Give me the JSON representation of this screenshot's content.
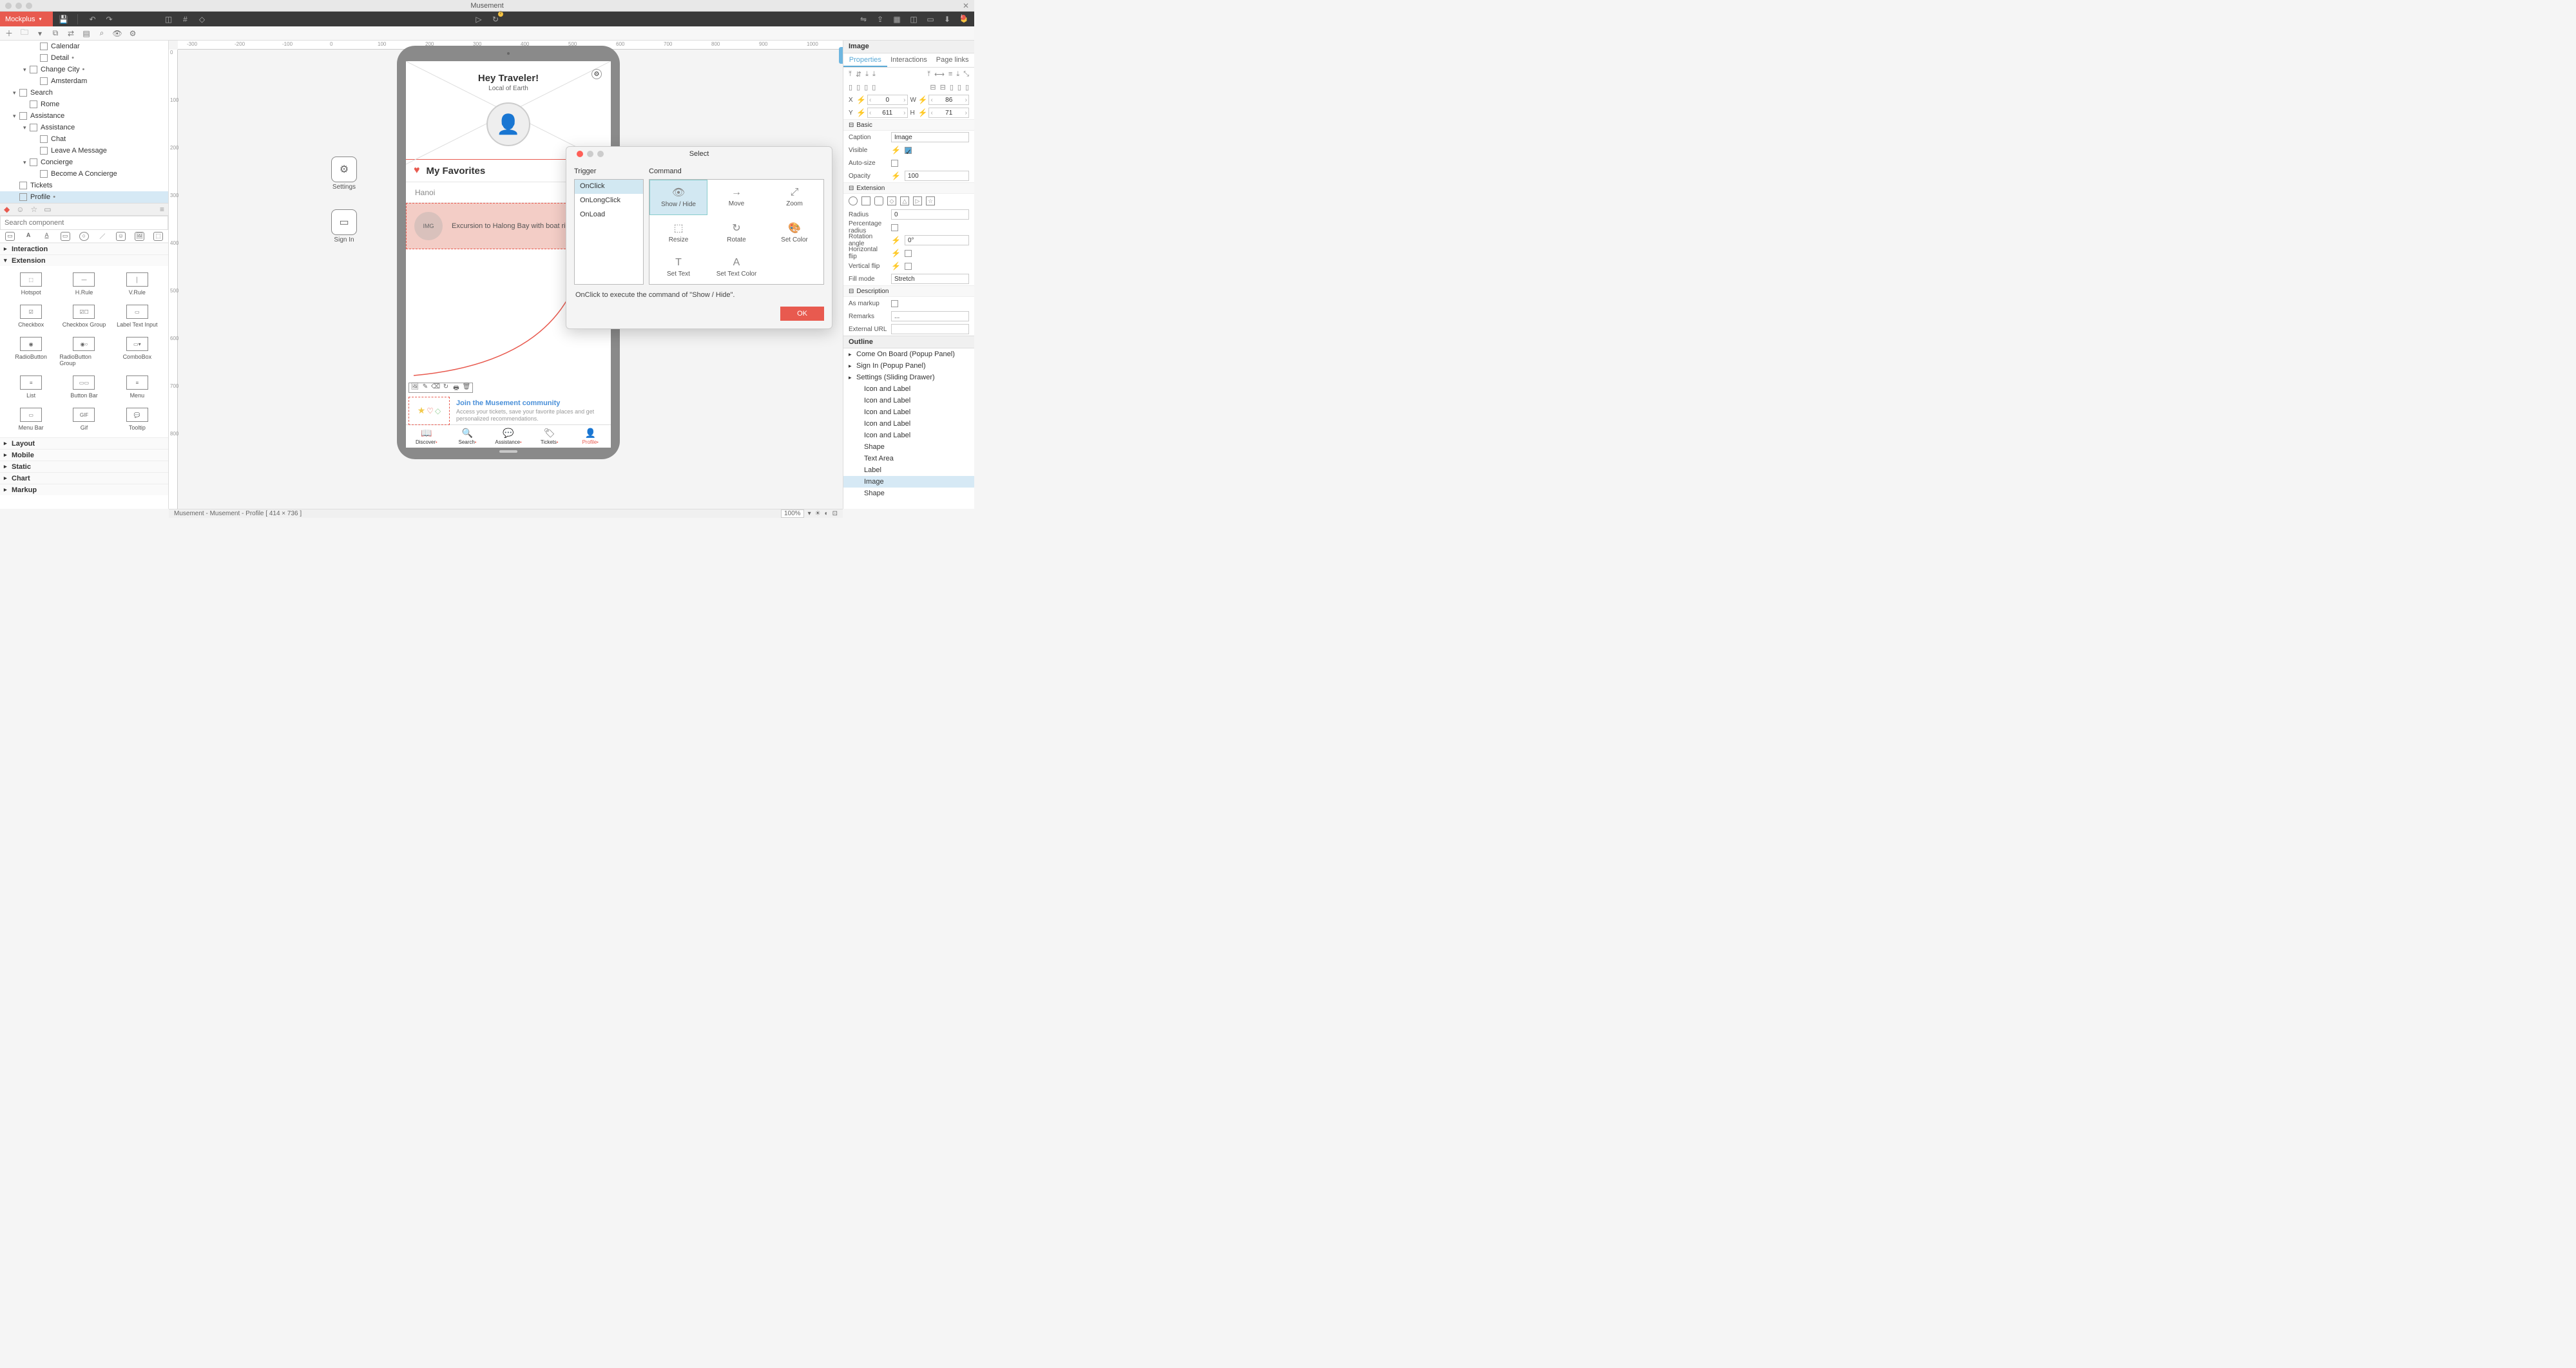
{
  "window": {
    "title": "Musement"
  },
  "brand": "Mockplus",
  "tree": [
    {
      "depth": 3,
      "label": "Calendar",
      "dot": false,
      "chev": ""
    },
    {
      "depth": 3,
      "label": "Detail",
      "dot": true,
      "chev": ""
    },
    {
      "depth": 2,
      "label": "Change City",
      "dot": true,
      "chev": "▾"
    },
    {
      "depth": 3,
      "label": "Amsterdam",
      "dot": false,
      "chev": ""
    },
    {
      "depth": 1,
      "label": "Search",
      "dot": false,
      "chev": "▾"
    },
    {
      "depth": 2,
      "label": "Rome",
      "dot": false,
      "chev": ""
    },
    {
      "depth": 1,
      "label": "Assistance",
      "dot": false,
      "chev": "▾"
    },
    {
      "depth": 2,
      "label": "Assistance",
      "dot": false,
      "chev": "▾"
    },
    {
      "depth": 3,
      "label": "Chat",
      "dot": false,
      "chev": ""
    },
    {
      "depth": 3,
      "label": "Leave A Message",
      "dot": false,
      "chev": ""
    },
    {
      "depth": 2,
      "label": "Concierge",
      "dot": false,
      "chev": "▾"
    },
    {
      "depth": 3,
      "label": "Become A Concierge",
      "dot": false,
      "chev": ""
    },
    {
      "depth": 1,
      "label": "Tickets",
      "dot": false,
      "chev": ""
    },
    {
      "depth": 1,
      "label": "Profile",
      "dot": true,
      "chev": "",
      "selected": true
    }
  ],
  "search": {
    "placeholder": "Search component"
  },
  "categories": {
    "interaction": "Interaction",
    "extension": "Extension",
    "layout": "Layout",
    "mobile": "Mobile",
    "static": "Static",
    "chart": "Chart",
    "markup": "Markup"
  },
  "components": [
    "Hotspot",
    "H.Rule",
    "V.Rule",
    "Checkbox",
    "Checkbox Group",
    "Label Text Input",
    "RadioButton",
    "RadioButton Group",
    "ComboBox",
    "List",
    "Button Bar",
    "Menu",
    "Menu Bar",
    "Gif",
    "Tooltip"
  ],
  "floaters": {
    "settings": "Settings",
    "signin": "Sign In"
  },
  "mock": {
    "greeting": "Hey Traveler!",
    "subtitle": "Local of Earth",
    "favHead": "My Favorites",
    "city": "Hanoi",
    "imgLabel": "IMG",
    "selText": "Excursion to Halong Bay with boat rid",
    "commTitle": "Join the Musement community",
    "commBody": "Access your tickets, save your favorite places and get personalized recommendations.",
    "tabs": [
      "Discover",
      "Search",
      "Assistance",
      "Tickets",
      "Profile"
    ]
  },
  "modal": {
    "title": "Select",
    "triggerHead": "Trigger",
    "commandHead": "Command",
    "triggers": [
      "OnClick",
      "OnLongClick",
      "OnLoad"
    ],
    "commands": [
      "Show / Hide",
      "Move",
      "Zoom",
      "Resize",
      "Rotate",
      "Set Color",
      "Set Text",
      "Set Text Color"
    ],
    "message": "OnClick to execute the command of \"Show / Hide\".",
    "ok": "OK"
  },
  "props": {
    "head": "Image",
    "tabs": [
      "Properties",
      "Interactions",
      "Page links"
    ],
    "X": "0",
    "Y": "611",
    "W": "86",
    "H": "71",
    "basic": "Basic",
    "caption": "Caption",
    "captionVal": "Image",
    "visible": "Visible",
    "autosize": "Auto-size",
    "opacity": "Opacity",
    "opacityVal": "100",
    "extension": "Extension",
    "radius": "Radius",
    "radiusVal": "0",
    "pradius": "Percentage radius",
    "rot": "Rotation angle",
    "rotVal": "0°",
    "hflip": "Horizontal flip",
    "vflip": "Vertical flip",
    "fill": "Fill mode",
    "fillVal": "Stretch",
    "desc": "Description",
    "markup": "As markup",
    "remarks": "Remarks",
    "remarksVal": "...",
    "url": "External URL"
  },
  "outline": {
    "head": "Outline",
    "items": [
      {
        "label": "Come On Board (Popup Panel)",
        "chev": "▸"
      },
      {
        "label": "Sign In (Popup Panel)",
        "chev": "▸"
      },
      {
        "label": "Settings (Sliding Drawer)",
        "chev": "▸"
      },
      {
        "label": "Icon and Label",
        "chev": ""
      },
      {
        "label": "Icon and Label",
        "chev": ""
      },
      {
        "label": "Icon and Label",
        "chev": ""
      },
      {
        "label": "Icon and Label",
        "chev": ""
      },
      {
        "label": "Icon and Label",
        "chev": ""
      },
      {
        "label": "Shape",
        "chev": ""
      },
      {
        "label": "Text Area",
        "chev": ""
      },
      {
        "label": "Label",
        "chev": ""
      },
      {
        "label": "Image",
        "chev": "",
        "sel": true
      },
      {
        "label": "Shape",
        "chev": ""
      }
    ]
  },
  "status": {
    "path": "Musement - Musement - Profile [ 414 × 736 ]",
    "zoom": "100%"
  },
  "ruler_h": [
    "-300",
    "-200",
    "-100",
    "0",
    "100",
    "200",
    "300",
    "400",
    "500",
    "600",
    "700",
    "800",
    "900",
    "1000"
  ],
  "ruler_v": [
    "0",
    "100",
    "200",
    "300",
    "400",
    "500",
    "600",
    "700",
    "800"
  ]
}
